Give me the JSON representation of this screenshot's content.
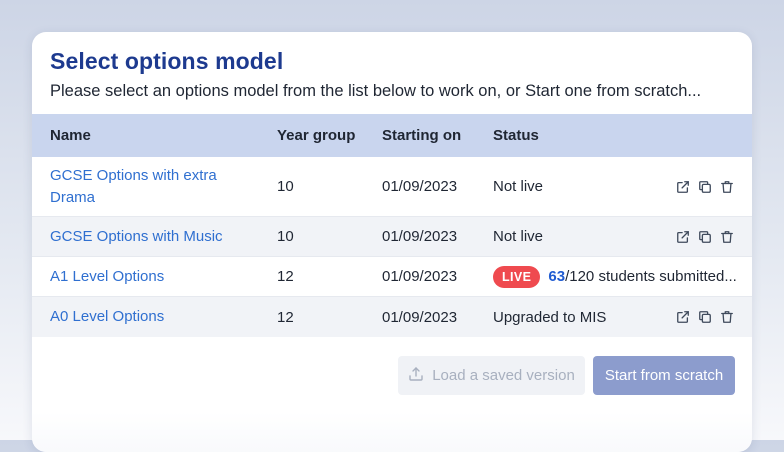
{
  "modal": {
    "title": "Select options model",
    "subtitle": "Please select an options model from the list below to work on, or Start one from scratch..."
  },
  "table": {
    "headers": {
      "name": "Name",
      "year": "Year group",
      "start": "Starting on",
      "status": "Status"
    },
    "rows": [
      {
        "name": "GCSE Options with extra Drama",
        "year": "10",
        "start": "01/09/2023",
        "status": "Not live"
      },
      {
        "name": "GCSE Options with Music",
        "year": "10",
        "start": "01/09/2023",
        "status": "Not live"
      },
      {
        "name": "A1 Level Options",
        "year": "12",
        "start": "01/09/2023",
        "live_badge": "LIVE",
        "submitted": "63",
        "submitted_suffix": "/120 students submitted..."
      },
      {
        "name": "A0 Level Options",
        "year": "12",
        "start": "01/09/2023",
        "status": "Upgraded to MIS"
      }
    ]
  },
  "footer": {
    "load_label": "Load a saved version",
    "start_label": "Start from scratch"
  },
  "colors": {
    "title": "#1d3a8f",
    "header_bg": "#c9d5ee",
    "link": "#2f6fd0",
    "live_badge": "#ef4a4f",
    "primary_button": "#8c9ccd"
  },
  "icons": [
    "external-link-icon",
    "copy-icon",
    "trash-icon",
    "upload-icon"
  ]
}
